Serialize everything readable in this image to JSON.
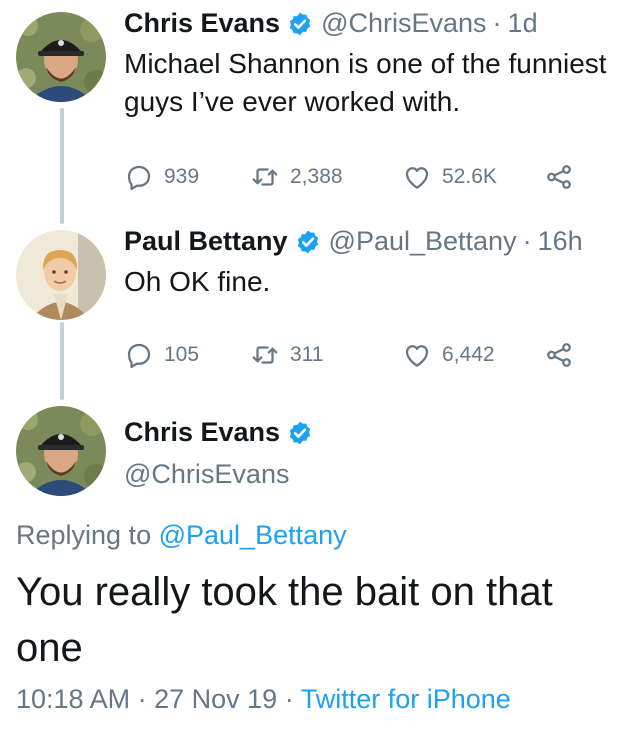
{
  "tweets": [
    {
      "name": "Chris Evans",
      "handle": "@ChrisEvans",
      "time": "1d",
      "text_lines": [
        "Michael Shannon is one of the funniest",
        "guys I’ve ever worked with."
      ],
      "stats": {
        "replies": "939",
        "retweets": "2,388",
        "likes": "52.6K"
      }
    },
    {
      "name": "Paul Bettany",
      "handle": "@Paul_Bettany",
      "time": "16h",
      "text_lines": [
        "Oh OK fine."
      ],
      "stats": {
        "replies": "105",
        "retweets": "311",
        "likes": "6,442"
      }
    }
  ],
  "main_tweet": {
    "name": "Chris Evans",
    "handle": "@ChrisEvans",
    "replying_prefix": "Replying to",
    "replying_to": "@Paul_Bettany",
    "text": "You really took the bait on that one",
    "time": "10:18 AM",
    "date": "27 Nov 19",
    "source": "Twitter for iPhone"
  },
  "separator": "·",
  "colors": {
    "accent": "#1da1f2",
    "secondary_text": "#657786",
    "thread_line": "#c4cfd6"
  },
  "icons": [
    "reply-icon",
    "retweet-icon",
    "like-icon",
    "share-icon",
    "verified-badge-icon"
  ]
}
